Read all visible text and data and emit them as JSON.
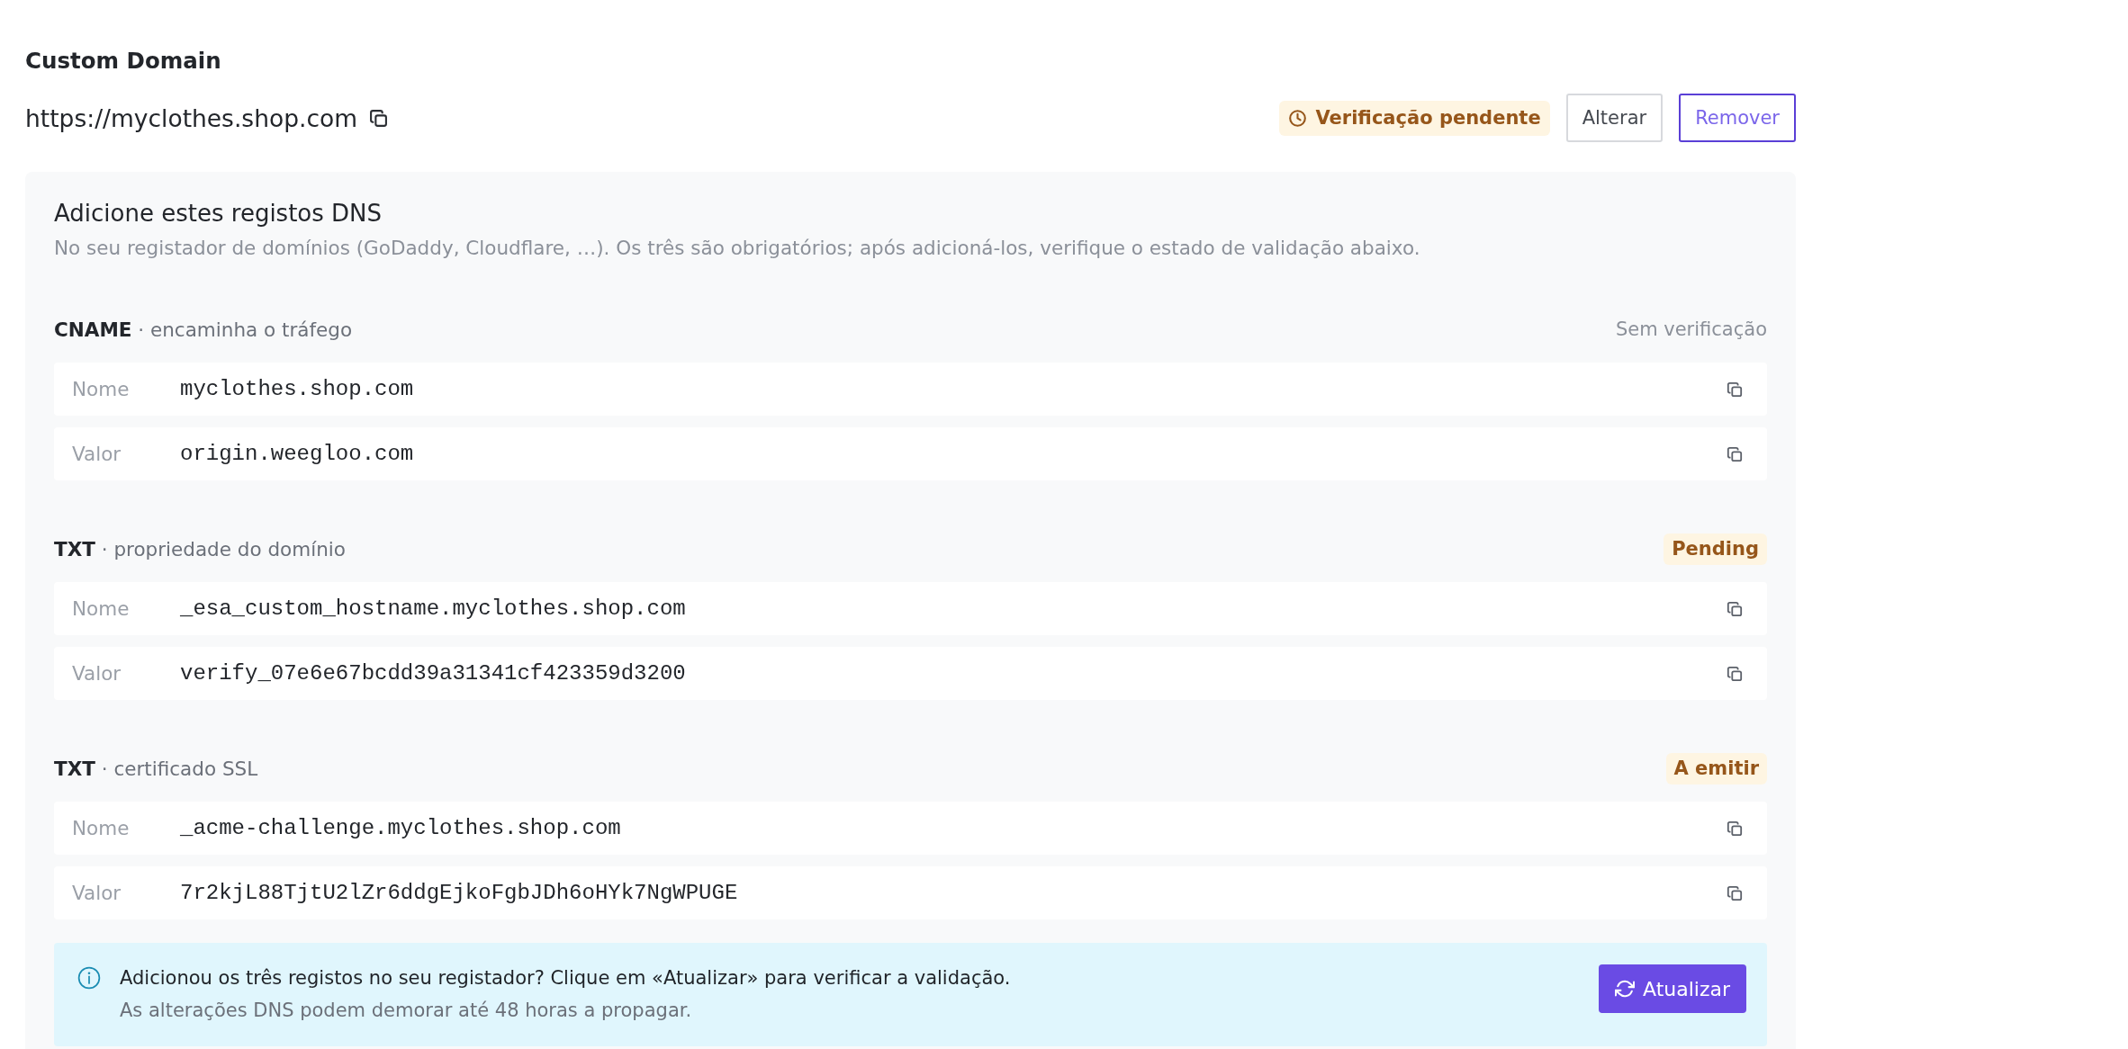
{
  "title": "Custom Domain",
  "domain": {
    "url": "https://myclothes.shop.com",
    "status": {
      "label": "Verificação pendente",
      "kind": "warning"
    },
    "buttons": [
      {
        "label": "Alterar",
        "kind": "secondary"
      },
      {
        "label": "Remover",
        "kind": "outline"
      }
    ]
  },
  "dns_panel": {
    "title": "Adicione estes registos DNS",
    "subtitle": "No seu registador de domínios (GoDaddy, Cloudflare, …). Os três são obrigatórios; após adicioná-los, verifique o estado de validação abaixo.",
    "records": [
      {
        "heading": "**CNAME** · encaminha o tráfego",
        "status": {
          "label": "Sem verificação",
          "kind": "plain"
        },
        "fields": [
          {
            "label": "Nome",
            "value": "myclothes.shop.com"
          },
          {
            "label": "Valor",
            "value": "origin.weegloo.com"
          }
        ]
      },
      {
        "heading": "**TXT** · propriedade do domínio",
        "status": {
          "label": "Pending",
          "kind": "warning"
        },
        "fields": [
          {
            "label": "Nome",
            "value": "_esa_custom_hostname.myclothes.shop.com"
          },
          {
            "label": "Valor",
            "value": "verify_07e6e67bcdd39a31341cf423359d3200"
          }
        ]
      },
      {
        "heading": "**TXT** · certificado SSL",
        "status": {
          "label": "A emitir",
          "kind": "warning"
        },
        "fields": [
          {
            "label": "Nome",
            "value": "_acme-challenge.myclothes.shop.com"
          },
          {
            "label": "Valor",
            "value": "7r2kjL88TjtU2lZr6ddgEjkoFgbJDh6oHYk7NgWPUGE"
          }
        ]
      }
    ],
    "notice": {
      "message": "Adicionou os três registos no seu registador? Clique em «Atualizar» para verificar a validação.",
      "note": "As alterações DNS podem demorar até 48 horas a propagar.",
      "button": "Atualizar"
    }
  }
}
